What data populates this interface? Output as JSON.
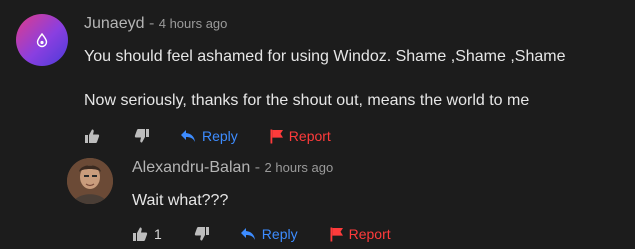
{
  "comments": [
    {
      "author": "Junaeyd",
      "separator": "-",
      "time": "4 hours ago",
      "lines": [
        "You should feel ashamed for using Windoz. Shame ,Shame ,Shame",
        "Now seriously, thanks for the shout out, means the world to me"
      ],
      "likes": "",
      "avatar_icon": "water-drop-icon"
    },
    {
      "author": "Alexandru-Balan",
      "separator": "-",
      "time": "2 hours ago",
      "lines": [
        "Wait what???"
      ],
      "likes": "1",
      "avatar_icon": "user-photo"
    }
  ],
  "actions": {
    "reply_label": "Reply",
    "report_label": "Report"
  },
  "colors": {
    "background": "#1c1c1c",
    "reply": "#3d8cff",
    "report": "#ff3b3b",
    "avatar_gradient_start": "#e03c8a",
    "avatar_gradient_end": "#4b3bd8"
  }
}
